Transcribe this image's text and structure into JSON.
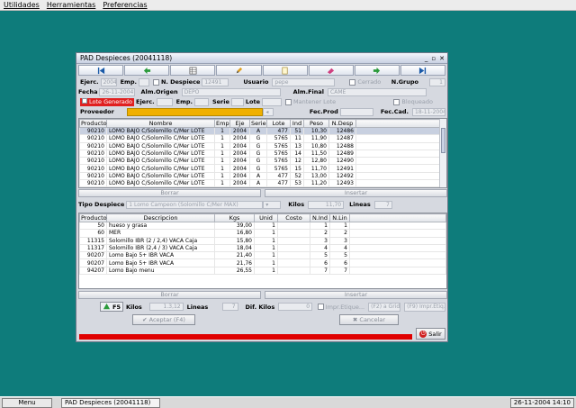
{
  "menubar": {
    "items": [
      "Utilidades",
      "Herramientas",
      "Preferencias"
    ]
  },
  "window": {
    "title": "PAD Despieces (20041118)"
  },
  "header": {
    "ejerc_label": "Ejerc.",
    "ejerc_value": "2004",
    "emp_label": "Emp.",
    "ndespiece_label": "N. Despiece",
    "ndespiece_value": "12491",
    "usuario_label": "Usuario",
    "usuario_value": "pepe",
    "cerrado_label": "Cerrado",
    "ngrupo_label": "N.Grupo",
    "ngrupo_value": "1",
    "fecha_label": "Fecha",
    "fecha_value": "26-11-2004",
    "almorigen_label": "Alm.Origen",
    "almorigen_value": "DEPO",
    "almfinal_label": "Alm.Final",
    "almfinal_value": "CAME",
    "lote_generado_label": "Lote Generado",
    "ejerc2_label": "Ejerc.",
    "emp2_label": "Emp.",
    "serie_label": "Serie",
    "lote_label": "Lote",
    "mantener_lote_label": "Mantener Lote",
    "bloqueado_label": "Bloqueado",
    "proveedor_label": "Proveedor",
    "fecprod_label": "Fec.Prod",
    "feccad_label": "Fec.Cad.",
    "feccad_value": "18-11-2004"
  },
  "table1": {
    "headers": [
      "Producto",
      "Nombre",
      "Emp",
      "Eje",
      "Serie",
      "Lote",
      "Ind",
      "Peso",
      "N.Desp"
    ],
    "rows": [
      [
        "90210",
        "LOMO BAJO C/Solomillo C/Mer LOTE",
        "1",
        "2004",
        "A",
        "477",
        "51",
        "10,30",
        "12486"
      ],
      [
        "90210",
        "LOMO BAJO C/Solomillo C/Mer LOTE",
        "1",
        "2004",
        "G",
        "5765",
        "11",
        "11,90",
        "12487"
      ],
      [
        "90210",
        "LOMO BAJO C/Solomillo C/Mer LOTE",
        "1",
        "2004",
        "G",
        "5765",
        "13",
        "10,80",
        "12488"
      ],
      [
        "90210",
        "LOMO BAJO C/Solomillo C/Mer LOTE",
        "1",
        "2004",
        "G",
        "5765",
        "14",
        "11,50",
        "12489"
      ],
      [
        "90210",
        "LOMO BAJO C/Solomillo C/Mer LOTE",
        "1",
        "2004",
        "G",
        "5765",
        "12",
        "12,80",
        "12490"
      ],
      [
        "90210",
        "LOMO BAJO C/Solomillo C/Mer LOTE",
        "1",
        "2004",
        "G",
        "5765",
        "15",
        "11,70",
        "12491"
      ],
      [
        "90210",
        "LOMO BAJO C/Solomillo C/Mer LOTE",
        "1",
        "2004",
        "A",
        "477",
        "52",
        "13,00",
        "12492"
      ],
      [
        "90210",
        "LOMO BAJO C/Solomillo C/Mer LOTE",
        "1",
        "2004",
        "A",
        "477",
        "53",
        "11,20",
        "12493"
      ]
    ]
  },
  "actions1": {
    "borrar": "Borrar",
    "insertar": "Insertar"
  },
  "middle": {
    "tipo_label": "Tipo Despiece",
    "tipo_value": "1 Lomo Campeon (Solomillo C/Mer MAX)",
    "kilos_label": "Kilos",
    "kilos_value": "11,70",
    "lineas_label": "Lineas",
    "lineas_value": "7"
  },
  "table2": {
    "headers": [
      "Producto",
      "Descripcion",
      "Kgs",
      "Unid",
      "Costo",
      "N.Ind",
      "N.Lin"
    ],
    "rows": [
      [
        "50",
        "hueso y grasa",
        "39,00",
        "1",
        "",
        "1",
        "1"
      ],
      [
        "60",
        "MER",
        "16,80",
        "1",
        "",
        "2",
        "2"
      ],
      [
        "11315",
        "Solomillo IBR (2 / 2,4) VACA    Caja",
        "15,80",
        "1",
        "",
        "3",
        "3"
      ],
      [
        "11317",
        "Solomillo IBR (2,4 / 3) VACA  Caja",
        "18,04",
        "1",
        "",
        "4",
        "4"
      ],
      [
        "90207",
        "Lomo Bajo 5+ IBR VACA",
        "21,40",
        "1",
        "",
        "5",
        "5"
      ],
      [
        "90207",
        "Lomo Bajo 5+ IBR VACA",
        "21,76",
        "1",
        "",
        "6",
        "6"
      ],
      [
        "94207",
        "Lomo Bajo menu",
        "26,55",
        "1",
        "",
        "7",
        "7"
      ]
    ]
  },
  "actions2": {
    "borrar": "Borrar",
    "insertar": "Insertar"
  },
  "footer": {
    "f5_label": "F5",
    "kilos_label": "Kilos",
    "kilos_value": "1.3,12",
    "lineas_label": "Lineas",
    "lineas_value": "7",
    "difkilos_label": "Dif. Kilos",
    "difkilos_value": "0",
    "impr_etiquetas": "Impr.Etique...",
    "f2_grid": "(F2) a Grid",
    "f9_impr": "(F9) Impr.Etiq.",
    "aceptar": "Aceptar (F4)",
    "cancelar": "Cancelar",
    "salir": "Salir"
  },
  "taskbar": {
    "menu": "Menu",
    "task": "PAD Despieces (20041118)",
    "clock": "26-11-2004  14:10"
  },
  "colors": {
    "desktop": "#0e7c7b",
    "accent_red": "#e00000",
    "proveedor_yellow": "#f0b000",
    "lote_red": "#e02020"
  }
}
